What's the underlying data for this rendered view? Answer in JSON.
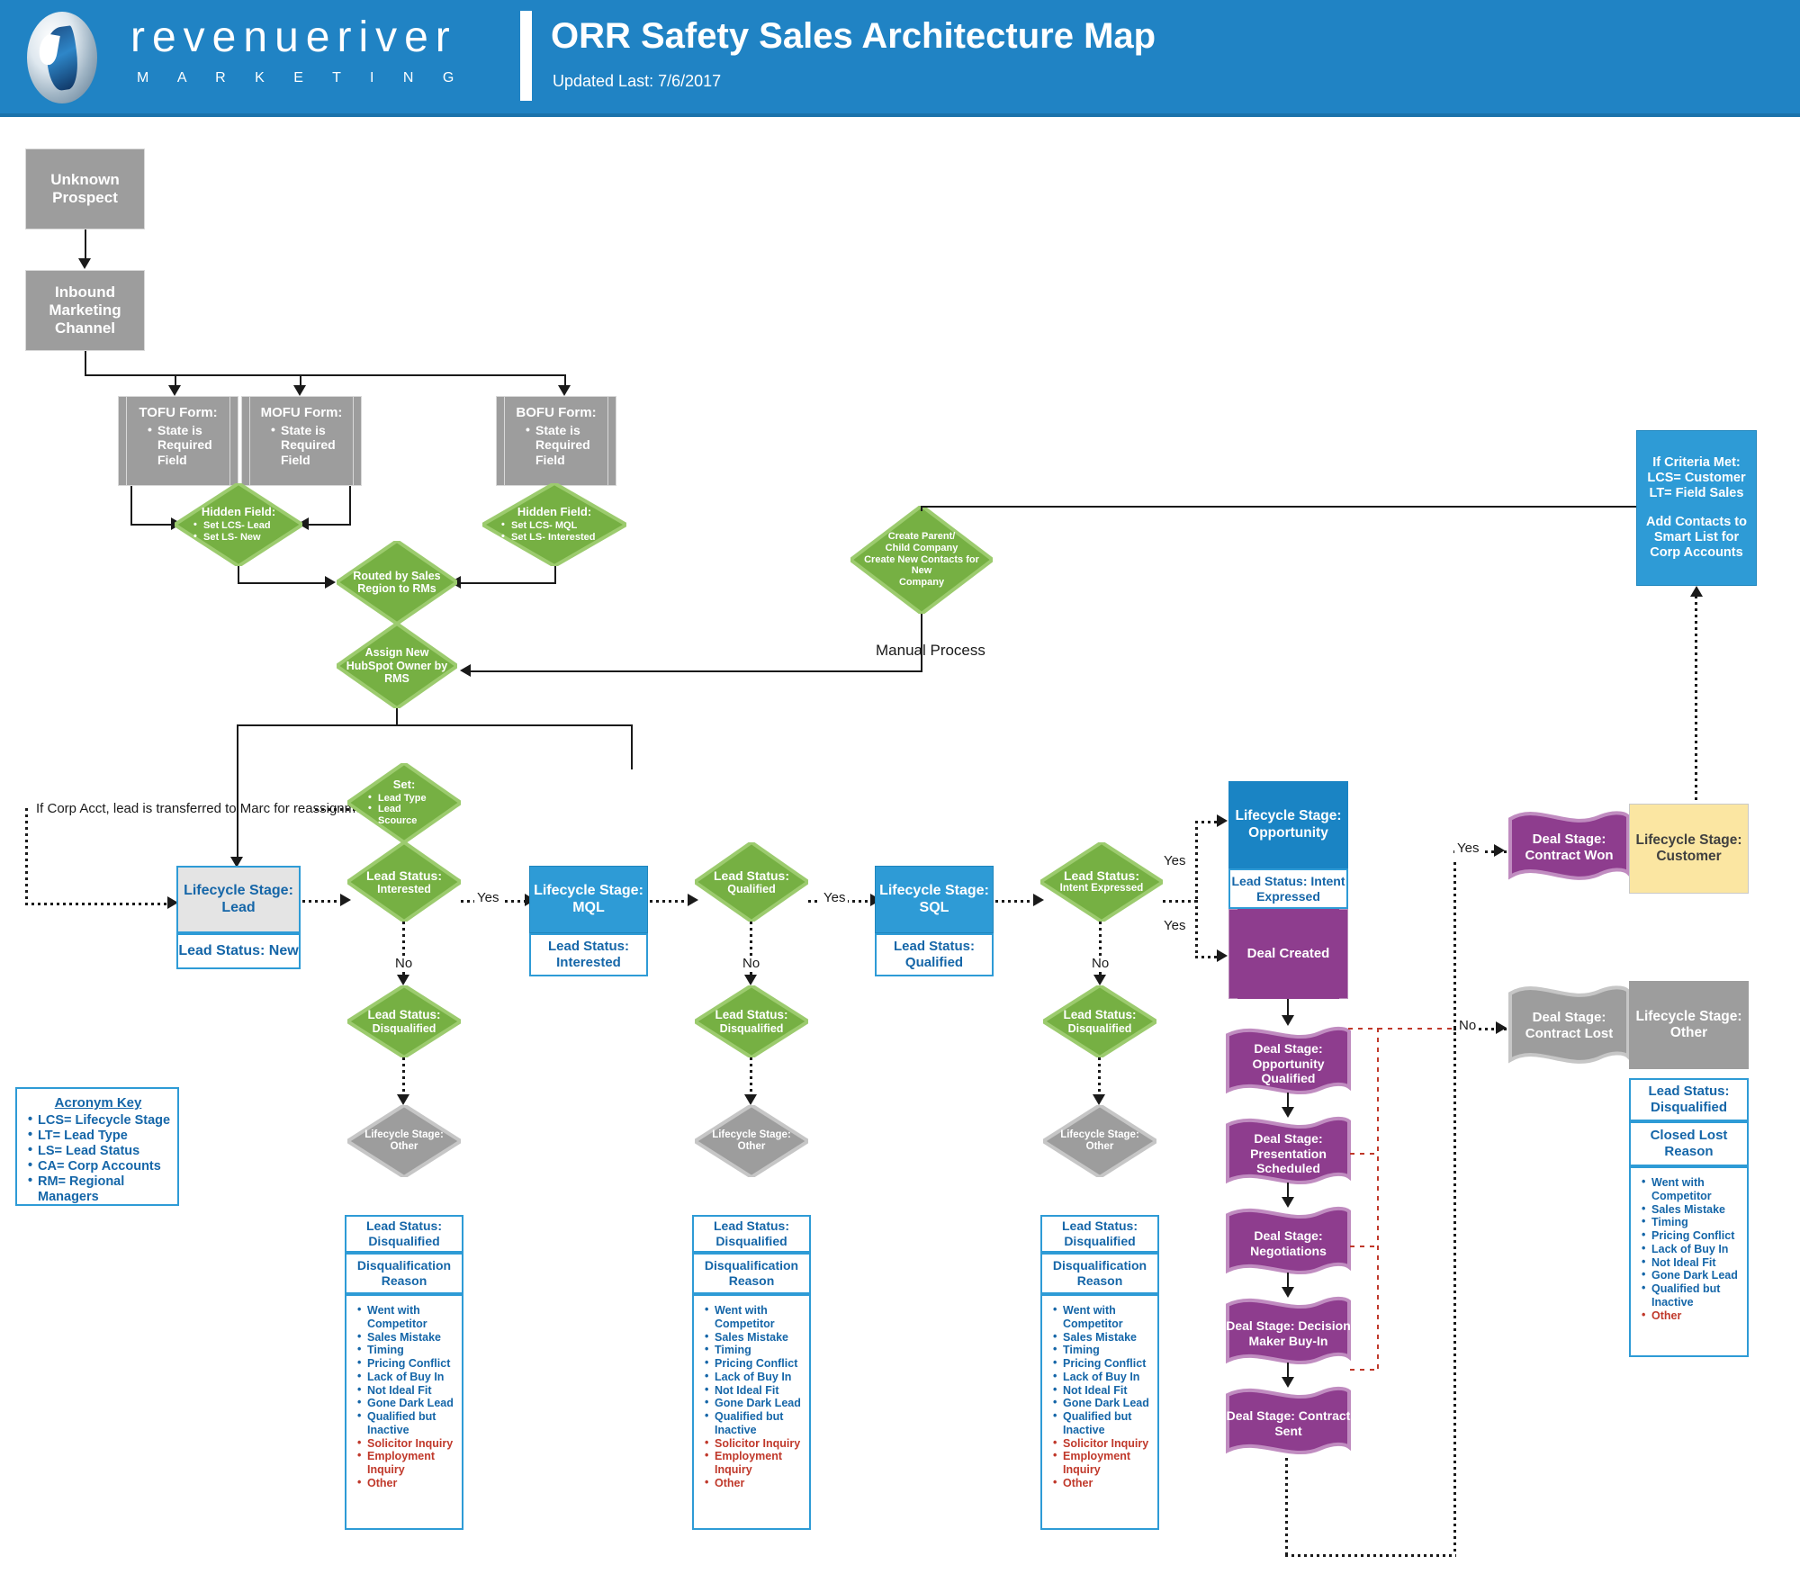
{
  "header": {
    "brand_word": "revenueriver",
    "brand_sub": "M A R K E T I N G",
    "title": "ORR Safety Sales Architecture Map",
    "updated": "Updated Last: 7/6/2017",
    "brand_color": "#2083c4"
  },
  "colors": {
    "gray": "#9d9d9d",
    "green": "#76b043",
    "blue": "#2e9bd6",
    "blue_dark": "#1a84c4",
    "purple": "#8e3d8e",
    "yellow": "#fbe6a2",
    "text_blue": "#1566a8",
    "text_red": "#c0392b"
  },
  "nodes": {
    "unknown_prospect": "Unknown Prospect",
    "inbound_channel": "Inbound Marketing Channel",
    "tofu_title": "TOFU Form:",
    "tofu_item": "State is Required Field",
    "mofu_title": "MOFU Form:",
    "mofu_item": "State is Required Field",
    "bofu_title": "BOFU Form:",
    "bofu_item": "State is Required Field",
    "hidden_left_title": "Hidden Field:",
    "hidden_left_item1": "Set LCS- Lead",
    "hidden_left_item2": "Set LS- New",
    "hidden_right_title": "Hidden Field:",
    "hidden_right_item1": "Set LCS- MQL",
    "hidden_right_item2": "Set LS- Interested",
    "routed_by_sales": "Routed by Sales Region to RMs",
    "assign_owner": "Assign New HubSpot Owner by RMS",
    "create_parent_child": "Create Parent/ Child Company\nCreate New Contacts for New\nCompany",
    "manual_process": "Manual Process",
    "criteria_met": "If Criteria Met:\nLCS= Customer\nLT= Field Sales\n\nAdd Contacts to Smart List for Corp Accounts",
    "set_title": "Set:",
    "set_item1": "Lead Type",
    "set_item2": "Lead Scource",
    "corp_acct_note": "If Corp Acct, lead is transferred to Marc for reassignment",
    "lcs_lead": "Lifecycle Stage: Lead",
    "ls_new": "Lead Status: New",
    "ls_interested_d": "Lead Status: Interested",
    "lcs_mql": "Lifecycle Stage: MQL",
    "ls_interested_sub": "Lead Status: Interested",
    "ls_qualified_d": "Lead Status: Qualified",
    "lcs_sql": "Lifecycle Stage: SQL",
    "ls_qualified_sub": "Lead Status: Qualified",
    "ls_intent_d": "Lead Status: Intent Expressed",
    "lcs_opportunity": "Lifecycle Stage: Opportunity",
    "ls_intent_sub": "Lead Status: Intent Expressed",
    "deal_created": "Deal Created",
    "ls_disqualified_d": "Lead Status: Disqualified",
    "lcs_other_d": "Lifecycle Stage: Other",
    "ls_disqualified_head": "Lead Status: Disqualified",
    "disq_reason_head": "Disqualification Reason",
    "deal_stage_opp_qualified": "Deal Stage: Opportunity Qualified",
    "deal_stage_presentation": "Deal Stage: Presentation Scheduled",
    "deal_stage_negotiations": "Deal Stage: Negotiations",
    "deal_stage_decision_maker": "Deal Stage: Decision Maker Buy-In",
    "deal_stage_contract_sent": "Deal Stage: Contract Sent",
    "deal_stage_contract_won": "Deal Stage: Contract Won",
    "lcs_customer": "Lifecycle Stage: Customer",
    "deal_stage_contract_lost": "Deal Stage: Contract Lost",
    "lcs_other_box": "Lifecycle Stage: Other",
    "closed_lost_head": "Closed Lost Reason"
  },
  "edge_labels": {
    "yes": "Yes",
    "no": "No"
  },
  "lists": {
    "disqualification_reasons_blue": [
      "Went with Competitor",
      "Sales Mistake",
      "Timing",
      "Pricing Conflict",
      "Lack of Buy In",
      "Not Ideal Fit",
      "Gone Dark Lead",
      "Qualified but Inactive"
    ],
    "disqualification_reasons_red": [
      "Solicitor Inquiry",
      "Employment Inquiry",
      "Other"
    ],
    "closed_lost_blue": [
      "Went with Competitor",
      "Sales Mistake",
      "Timing",
      "Pricing Conflict",
      "Lack of Buy In",
      "Not Ideal Fit",
      "Gone Dark Lead",
      "Qualified but Inactive"
    ],
    "closed_lost_red": [
      "Other"
    ]
  },
  "acronym_key": {
    "title": "Acronym Key",
    "items": [
      "LCS= Lifecycle Stage",
      "LT= Lead Type",
      "LS= Lead Status",
      "CA= Corp Accounts",
      "RM= Regional Managers"
    ]
  }
}
